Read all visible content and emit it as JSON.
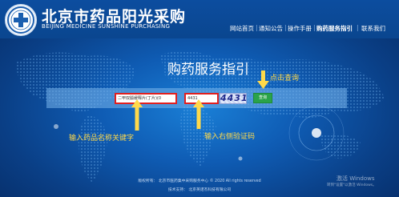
{
  "header": {
    "brand_cn": "北京市药品阳光采购",
    "brand_en": "BEIJING MEDICINE SUNSHINE PURCHASING",
    "nav": [
      {
        "label": "网站首页"
      },
      {
        "label": "通知公告"
      },
      {
        "label": "操作手册"
      },
      {
        "label": "购药服务指引"
      },
      {
        "label": "联系我们"
      }
    ],
    "active_nav_index": 3
  },
  "main": {
    "title": "购药服务指引",
    "keyword_value": "二甲双胍缓释片(丁片)(0",
    "code_value": "4431",
    "captcha_text": "4431",
    "query_label": "查询",
    "callout_query": "点击查询",
    "callout_keyword": "输入药品名称关键字",
    "callout_code": "输入右侧验证码"
  },
  "footer": {
    "line1": "版权所有：  北京市医药集中采购服务中心 © 2020 All rights reserved",
    "line2": "技术支持：  北京英诺杰科技有限公司"
  },
  "watermark": {
    "line1": "激活 Windows",
    "line2": "转到\"设置\"以激活 Windows。"
  },
  "colors": {
    "header_bg": "#0c4d9f",
    "accent_callout": "#ffd94a",
    "input_border": "#e02020",
    "query_button": "#2aa34a"
  }
}
